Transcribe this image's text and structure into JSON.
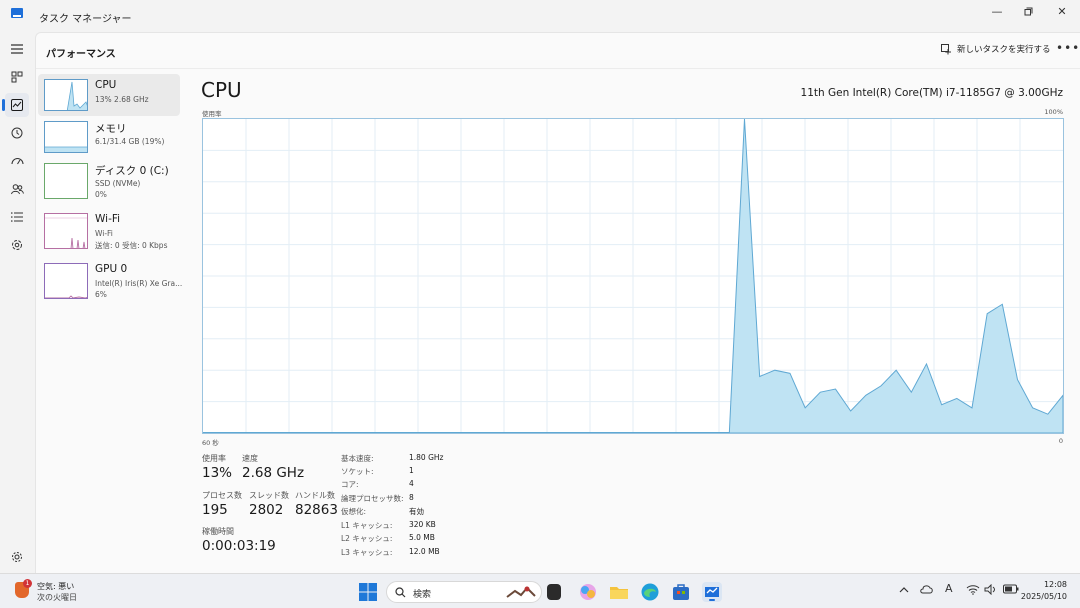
{
  "app": {
    "title": "タスク マネージャー"
  },
  "header": {
    "title": "パフォーマンス",
    "run_task_label": "新しいタスクを実行する"
  },
  "devices": [
    {
      "name": "CPU",
      "sub1": "13% 2.68 GHz"
    },
    {
      "name": "メモリ",
      "sub1": "6.1/31.4 GB (19%)"
    },
    {
      "name": "ディスク 0 (C:)",
      "sub1": "SSD (NVMe)",
      "sub2": "0%"
    },
    {
      "name": "Wi-Fi",
      "sub1": "Wi-Fi",
      "sub2": "送信: 0 受信: 0 Kbps"
    },
    {
      "name": "GPU 0",
      "sub1": "Intel(R) Iris(R) Xe Gra...",
      "sub2": "6%"
    }
  ],
  "cpu": {
    "title": "CPU",
    "model": "11th Gen Intel(R) Core(TM) i7-1185G7 @ 3.00GHz",
    "graph_label": "使用率",
    "graph_max": "100%",
    "graph_left": "60 秒",
    "graph_right": "0",
    "stats": {
      "usage_label": "使用率",
      "usage": "13%",
      "speed_label": "速度",
      "speed": "2.68 GHz",
      "processes_label": "プロセス数",
      "processes": "195",
      "threads_label": "スレッド数",
      "threads": "2802",
      "handles_label": "ハンドル数",
      "handles": "82863",
      "uptime_label": "稼働時間",
      "uptime": "0:00:03:19"
    },
    "info": [
      {
        "k": "基本速度:",
        "v": "1.80 GHz"
      },
      {
        "k": "ソケット:",
        "v": "1"
      },
      {
        "k": "コア:",
        "v": "4"
      },
      {
        "k": "論理プロセッサ数:",
        "v": "8"
      },
      {
        "k": "仮想化:",
        "v": "有効"
      },
      {
        "k": "L1 キャッシュ:",
        "v": "320 KB"
      },
      {
        "k": "L2 キャッシュ:",
        "v": "5.0 MB"
      },
      {
        "k": "L3 キャッシュ:",
        "v": "12.0 MB"
      }
    ]
  },
  "chart_data": {
    "type": "area",
    "x": [
      60,
      58,
      56,
      54,
      52,
      50,
      48,
      46,
      44,
      42,
      40,
      38,
      36,
      34,
      32,
      30,
      28,
      26,
      24,
      22,
      20,
      18,
      16,
      14,
      12,
      10,
      8,
      6,
      4,
      2,
      0
    ],
    "values": [
      0,
      0,
      0,
      0,
      0,
      0,
      0,
      0,
      0,
      0,
      0,
      0,
      0,
      0,
      0,
      0,
      0,
      0,
      0,
      0,
      0,
      0,
      0,
      0,
      0,
      100,
      18,
      20,
      8,
      14,
      0
    ],
    "ylim": [
      0,
      100
    ],
    "tail": [
      0,
      100,
      18,
      20,
      19,
      8,
      13,
      14,
      7,
      12,
      15,
      20,
      13,
      22,
      9,
      11,
      8,
      38,
      41,
      17,
      8,
      6,
      12
    ],
    "ylabel": "使用率",
    "grid": true,
    "colors": {
      "line": "#5fa8d3",
      "fill": "#bfe3f3",
      "grid": "#e3eef6"
    }
  },
  "taskbar": {
    "weather_line1": "空気: 悪い",
    "weather_line2": "次の火曜日",
    "weather_badge": "1",
    "search_placeholder": "検索",
    "time": "12:08",
    "date": "2025/05/10"
  }
}
